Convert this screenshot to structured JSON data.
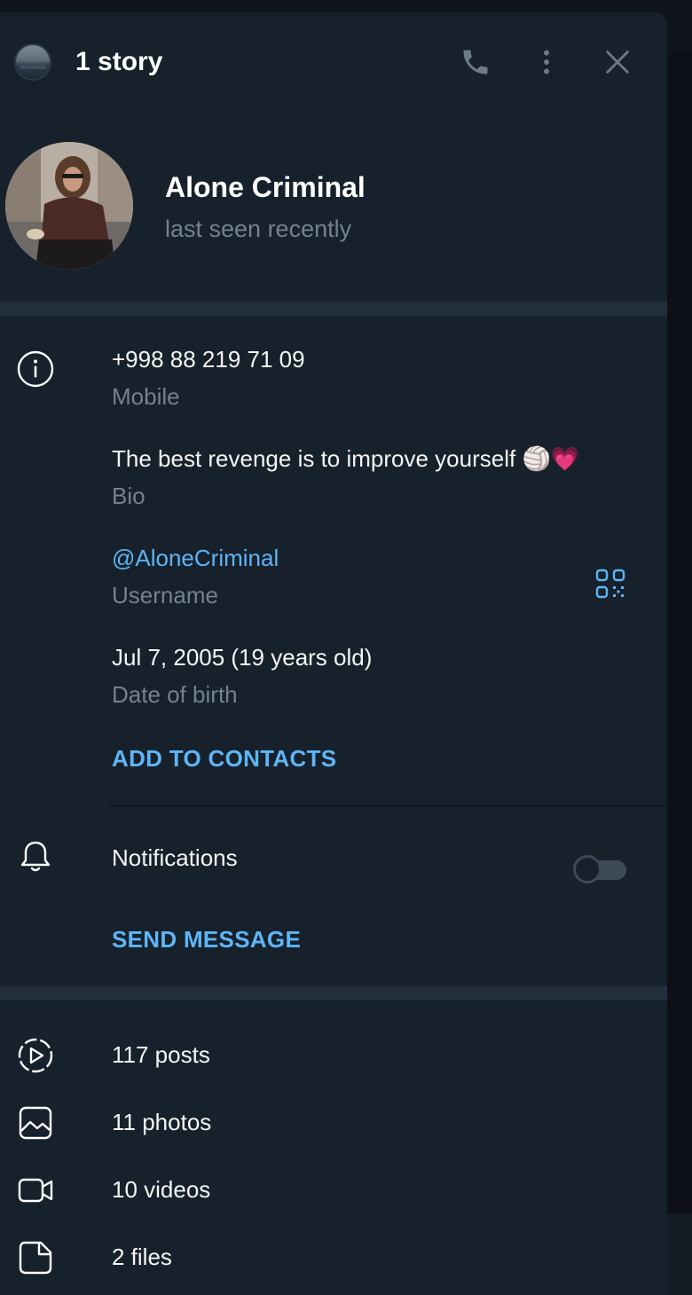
{
  "header": {
    "story_count_label": "1 story"
  },
  "profile": {
    "name": "Alone Criminal",
    "status": "last seen recently"
  },
  "info": {
    "phone": {
      "value": "+998 88 219 71 09",
      "label": "Mobile"
    },
    "bio": {
      "value": "The best revenge is to improve yourself 🏐💗",
      "label": "Bio"
    },
    "username": {
      "value": "@AloneCriminal",
      "label": "Username"
    },
    "birthday": {
      "value": "Jul 7, 2005 (19 years old)",
      "label": "Date of birth"
    },
    "add_contact_label": "ADD TO CONTACTS"
  },
  "notifications": {
    "label": "Notifications",
    "enabled": false
  },
  "send_message_label": "SEND MESSAGE",
  "media": [
    {
      "icon": "posts-play-icon",
      "label": "117 posts"
    },
    {
      "icon": "photo-icon",
      "label": "11 photos"
    },
    {
      "icon": "video-icon",
      "label": "10 videos"
    },
    {
      "icon": "file-icon",
      "label": "2 files"
    }
  ],
  "colors": {
    "panel_bg": "#17212b",
    "accent": "#5eb5f7",
    "secondary_text": "#74818f",
    "divider": "#232e3c"
  }
}
